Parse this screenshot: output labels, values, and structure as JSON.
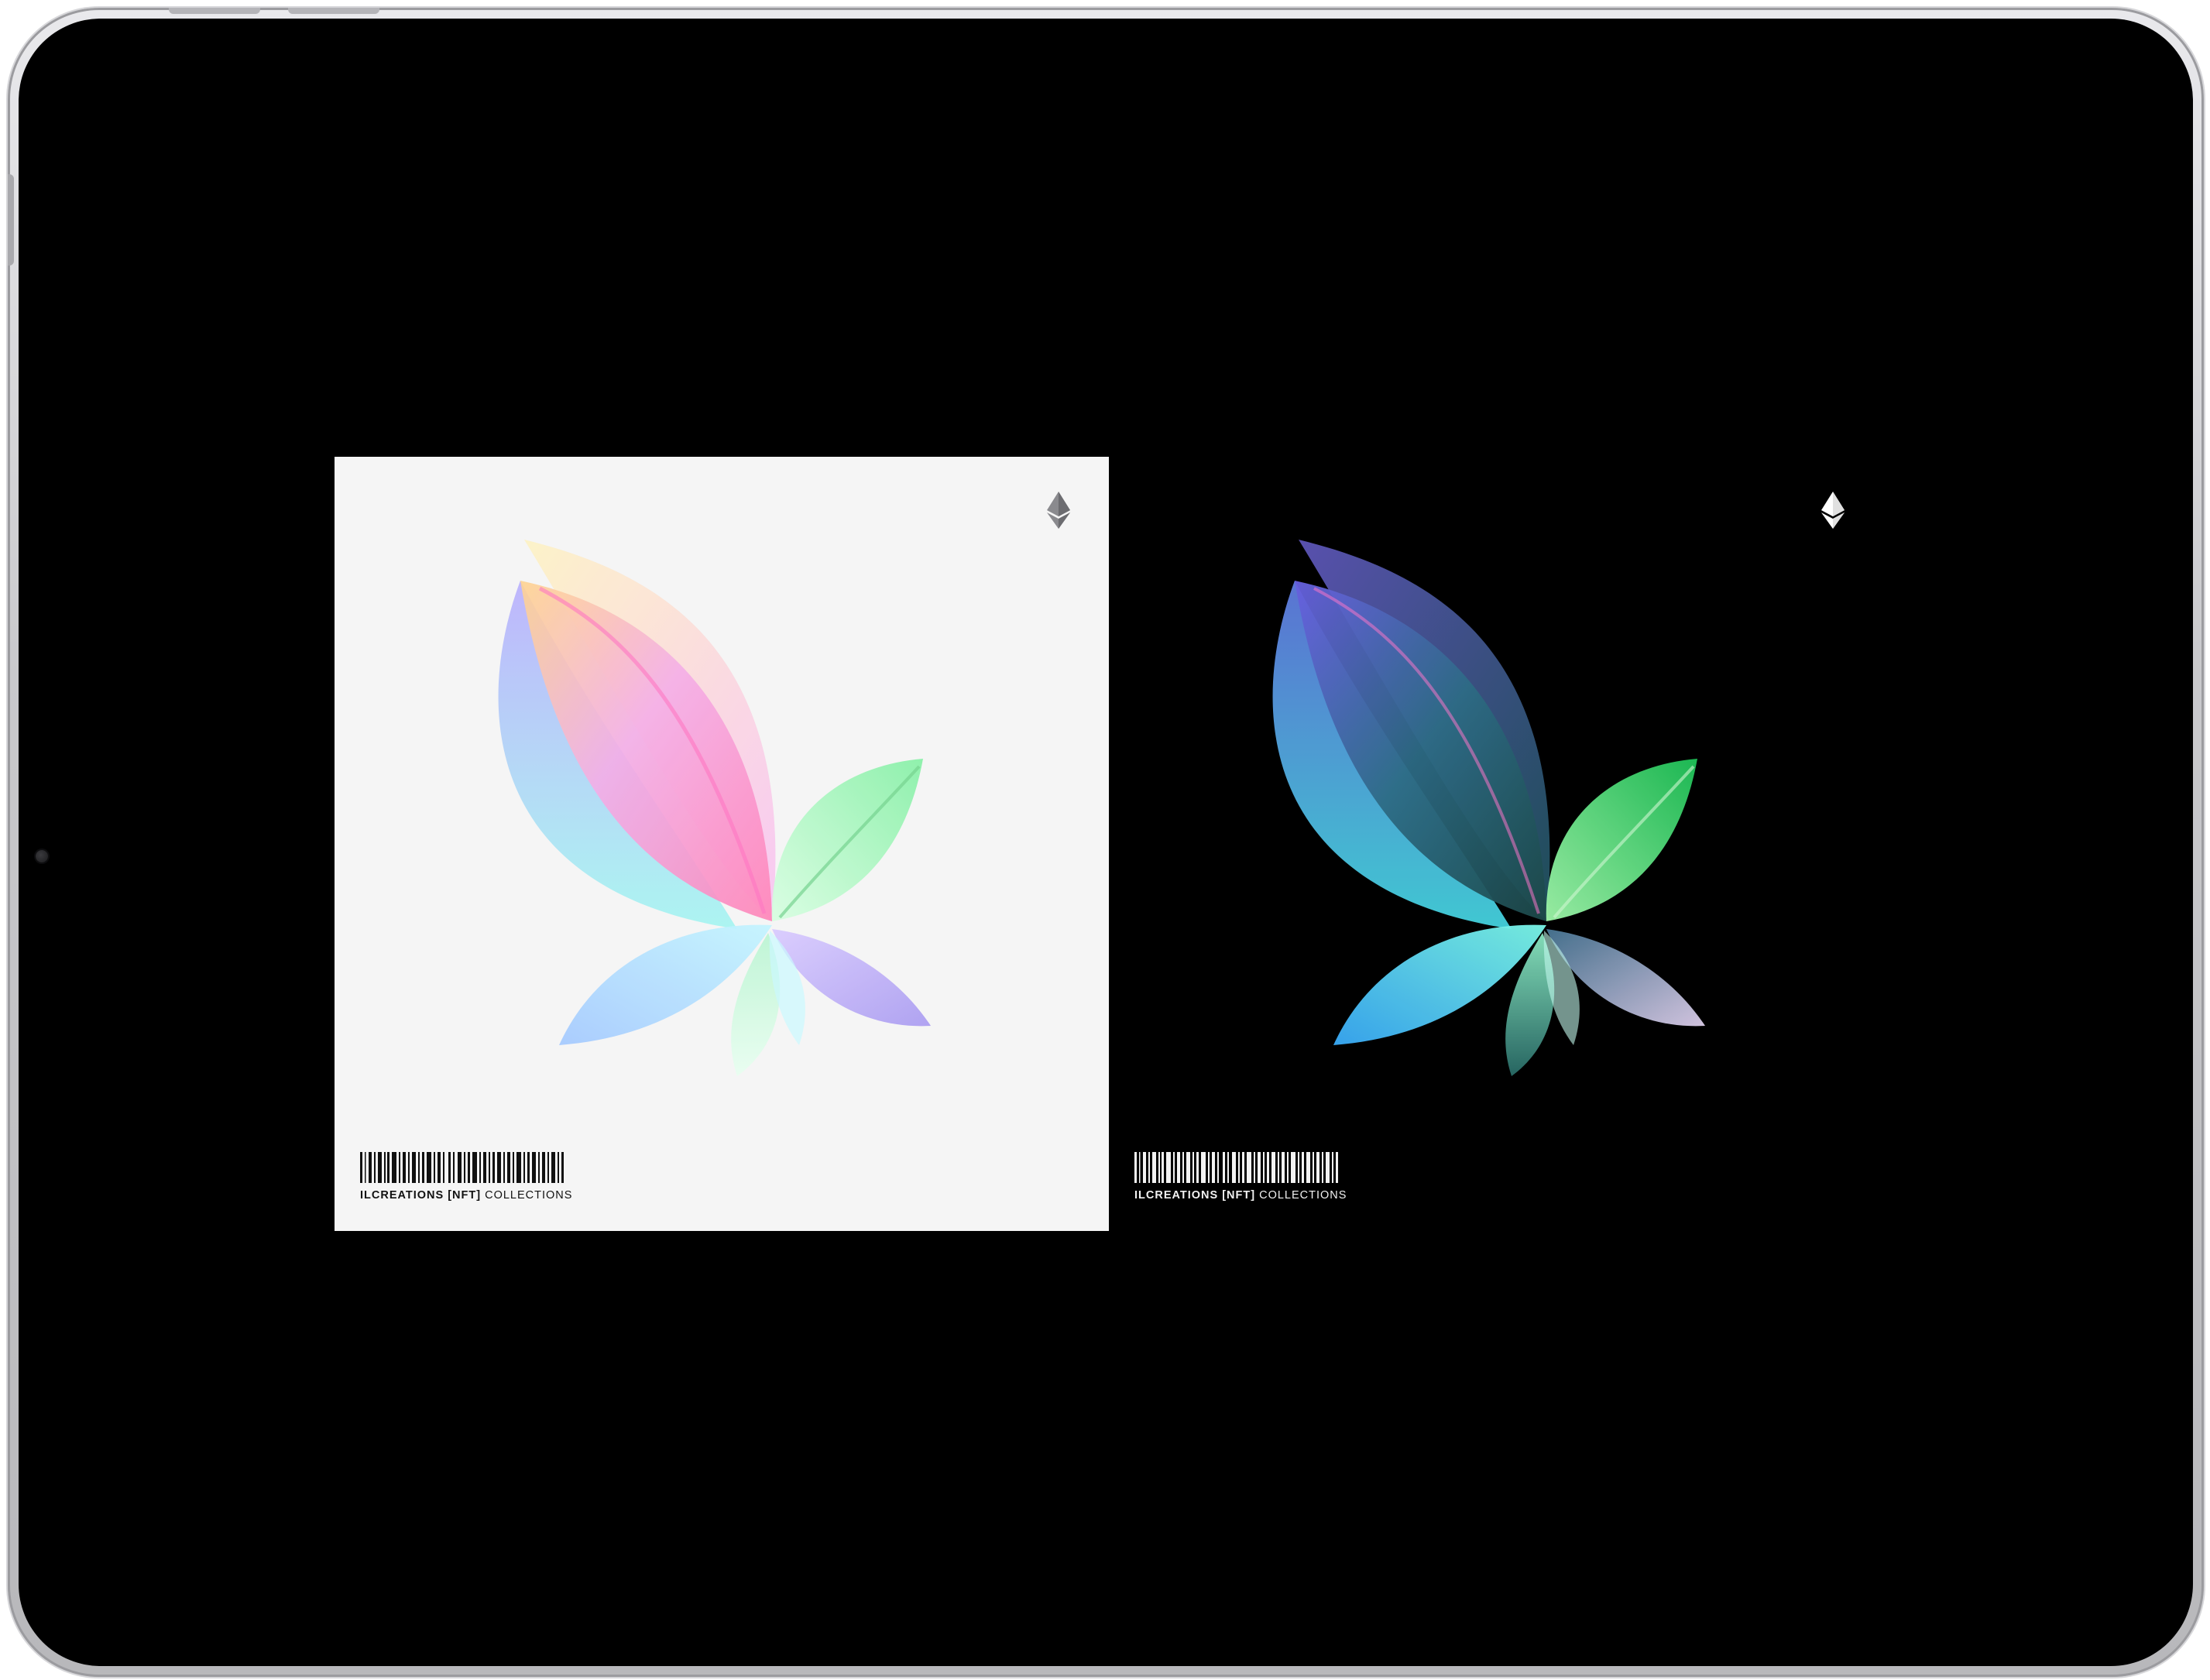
{
  "cards": [
    {
      "variant": "light",
      "brand": "ILCREATIONS [NFT]",
      "sub": "COLLECTIONS",
      "background": "#f5f5f5",
      "icon": "ethereum-icon"
    },
    {
      "variant": "dark",
      "brand": "ILCREATIONS [NFT]",
      "sub": "COLLECTIONS",
      "background": "#000000",
      "icon": "ethereum-icon"
    }
  ]
}
